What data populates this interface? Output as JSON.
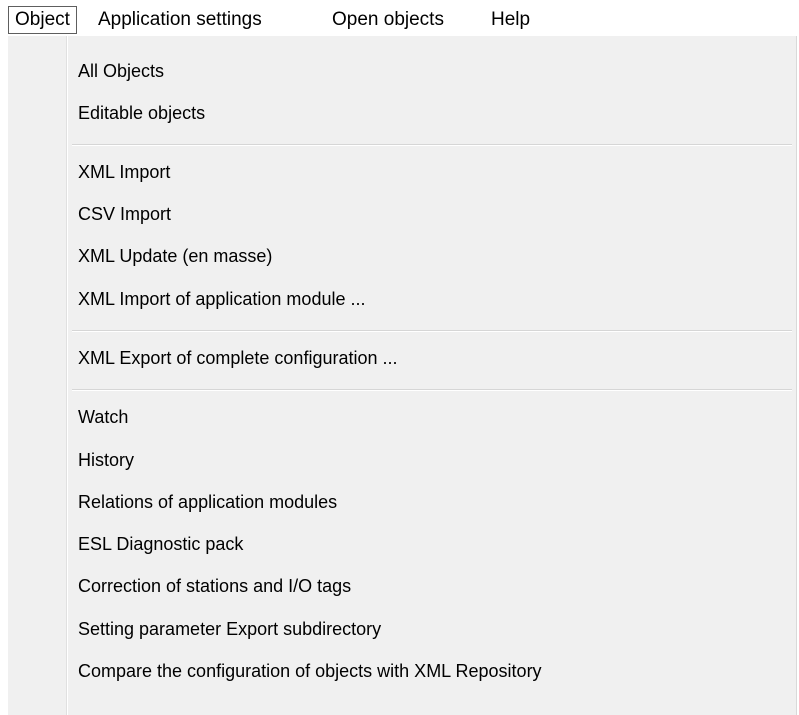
{
  "menubar": {
    "items": [
      {
        "label": "Object",
        "open": true
      },
      {
        "label": "Application settings"
      },
      {
        "label": "Open objects"
      },
      {
        "label": "Help"
      }
    ]
  },
  "dropdown": {
    "groups": [
      [
        "All Objects",
        "Editable objects"
      ],
      [
        "XML Import",
        "CSV Import",
        "XML Update (en masse)",
        "XML Import of application module ..."
      ],
      [
        "XML Export of complete configuration ..."
      ],
      [
        "Watch",
        "History",
        "Relations of application modules",
        "ESL Diagnostic pack",
        "Correction of stations and I/O tags",
        "Setting parameter Export subdirectory",
        "Compare the configuration of objects with XML Repository"
      ]
    ]
  }
}
